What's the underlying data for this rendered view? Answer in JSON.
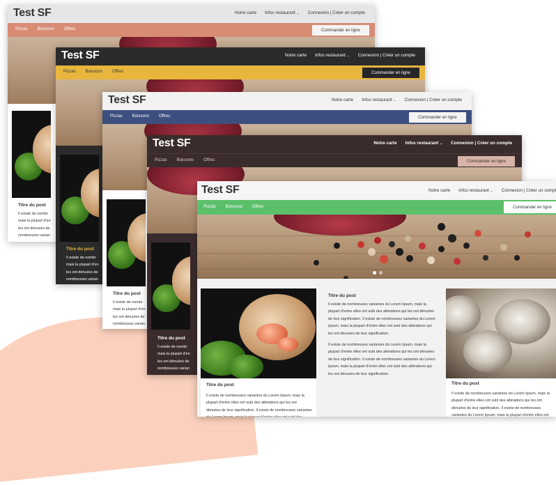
{
  "brand": "Test SF",
  "nav": {
    "carte": "Notre carte",
    "infos": "Infos restaurant",
    "connexion": "Connexion |",
    "compte": "Créer un compte",
    "caret": "⌄"
  },
  "subnav": {
    "pizzas": "Pizzas",
    "boissons": "Boissons",
    "offres": "Offres"
  },
  "order_label": "Commander en ligne",
  "post": {
    "title": "Titre du post",
    "body": "Il existe de nombreuses variantes du Lorem Ipsum, mais la plupart d'entre elles ont subi des altérations qui les ont dénuées de leur signification. Il existe de nombreuses variantes du Lorem Ipsum, mais la plupart d'entre elles ont subi des altérations qui les ont dénuées de leur signification.",
    "body_short": "Il existe de nombreuses variantes du Lorem Ipsum, mais la plupart d'entre elles ont subi des altérations qui les ont dénuées de leur signification.",
    "frag1": "Il existe de nombr",
    "frag2": "mais la plupart d'en",
    "frag3": "les ont dénuées de",
    "frag4": "nombreuses varian"
  },
  "themes": [
    {
      "header_bg": "#e6e6e6",
      "header_fg": "#333333",
      "sub_bg": "#d98c74",
      "sub_fg": "#ffffff",
      "order_bg": "#f4f4f4",
      "order_fg": "#333333",
      "body_bg": "#ffffff",
      "title_fg": "#333333"
    },
    {
      "header_bg": "#2b2b2b",
      "header_fg": "#ffffff",
      "sub_bg": "#e8b63c",
      "sub_fg": "#333333",
      "order_bg": "#262626",
      "order_fg": "#ffffff",
      "body_bg": "#2b2b2b",
      "title_fg": "#e8b63c"
    },
    {
      "header_bg": "#f2f2f2",
      "header_fg": "#333333",
      "sub_bg": "#3d4f7e",
      "sub_fg": "#ffffff",
      "order_bg": "#f4f4f4",
      "order_fg": "#333333",
      "body_bg": "#ffffff",
      "title_fg": "#333333"
    },
    {
      "header_bg": "#3a2c2c",
      "header_fg": "#ffffff",
      "sub_bg": "#3a2c2c",
      "sub_fg": "#e0c8c0",
      "order_bg": "#d9b3a8",
      "order_fg": "#3a2c2c",
      "body_bg": "#3a2c2c",
      "title_fg": "#ffffff"
    },
    {
      "header_bg": "#f5f5f5",
      "header_fg": "#333333",
      "sub_bg": "#5cc06b",
      "sub_fg": "#ffffff",
      "order_bg": "#ffffff",
      "order_fg": "#333333",
      "body_bg": "#f2f2f2",
      "title_fg": "#333333"
    }
  ]
}
